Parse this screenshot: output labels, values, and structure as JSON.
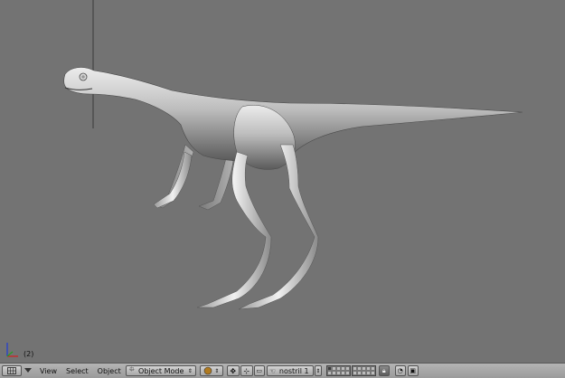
{
  "viewport": {
    "frame_label": "(2)"
  },
  "header": {
    "editor_type_icon": "grid-icon",
    "menus": {
      "view": "View",
      "select": "Select",
      "object": "Object"
    },
    "mode": "Object Mode",
    "bone_name": "nostril 1",
    "layers_active": [
      1
    ]
  },
  "colors": {
    "viewport_bg": "#737373",
    "header_bg": "#a8a8a8",
    "model": "#c8c8c8"
  }
}
